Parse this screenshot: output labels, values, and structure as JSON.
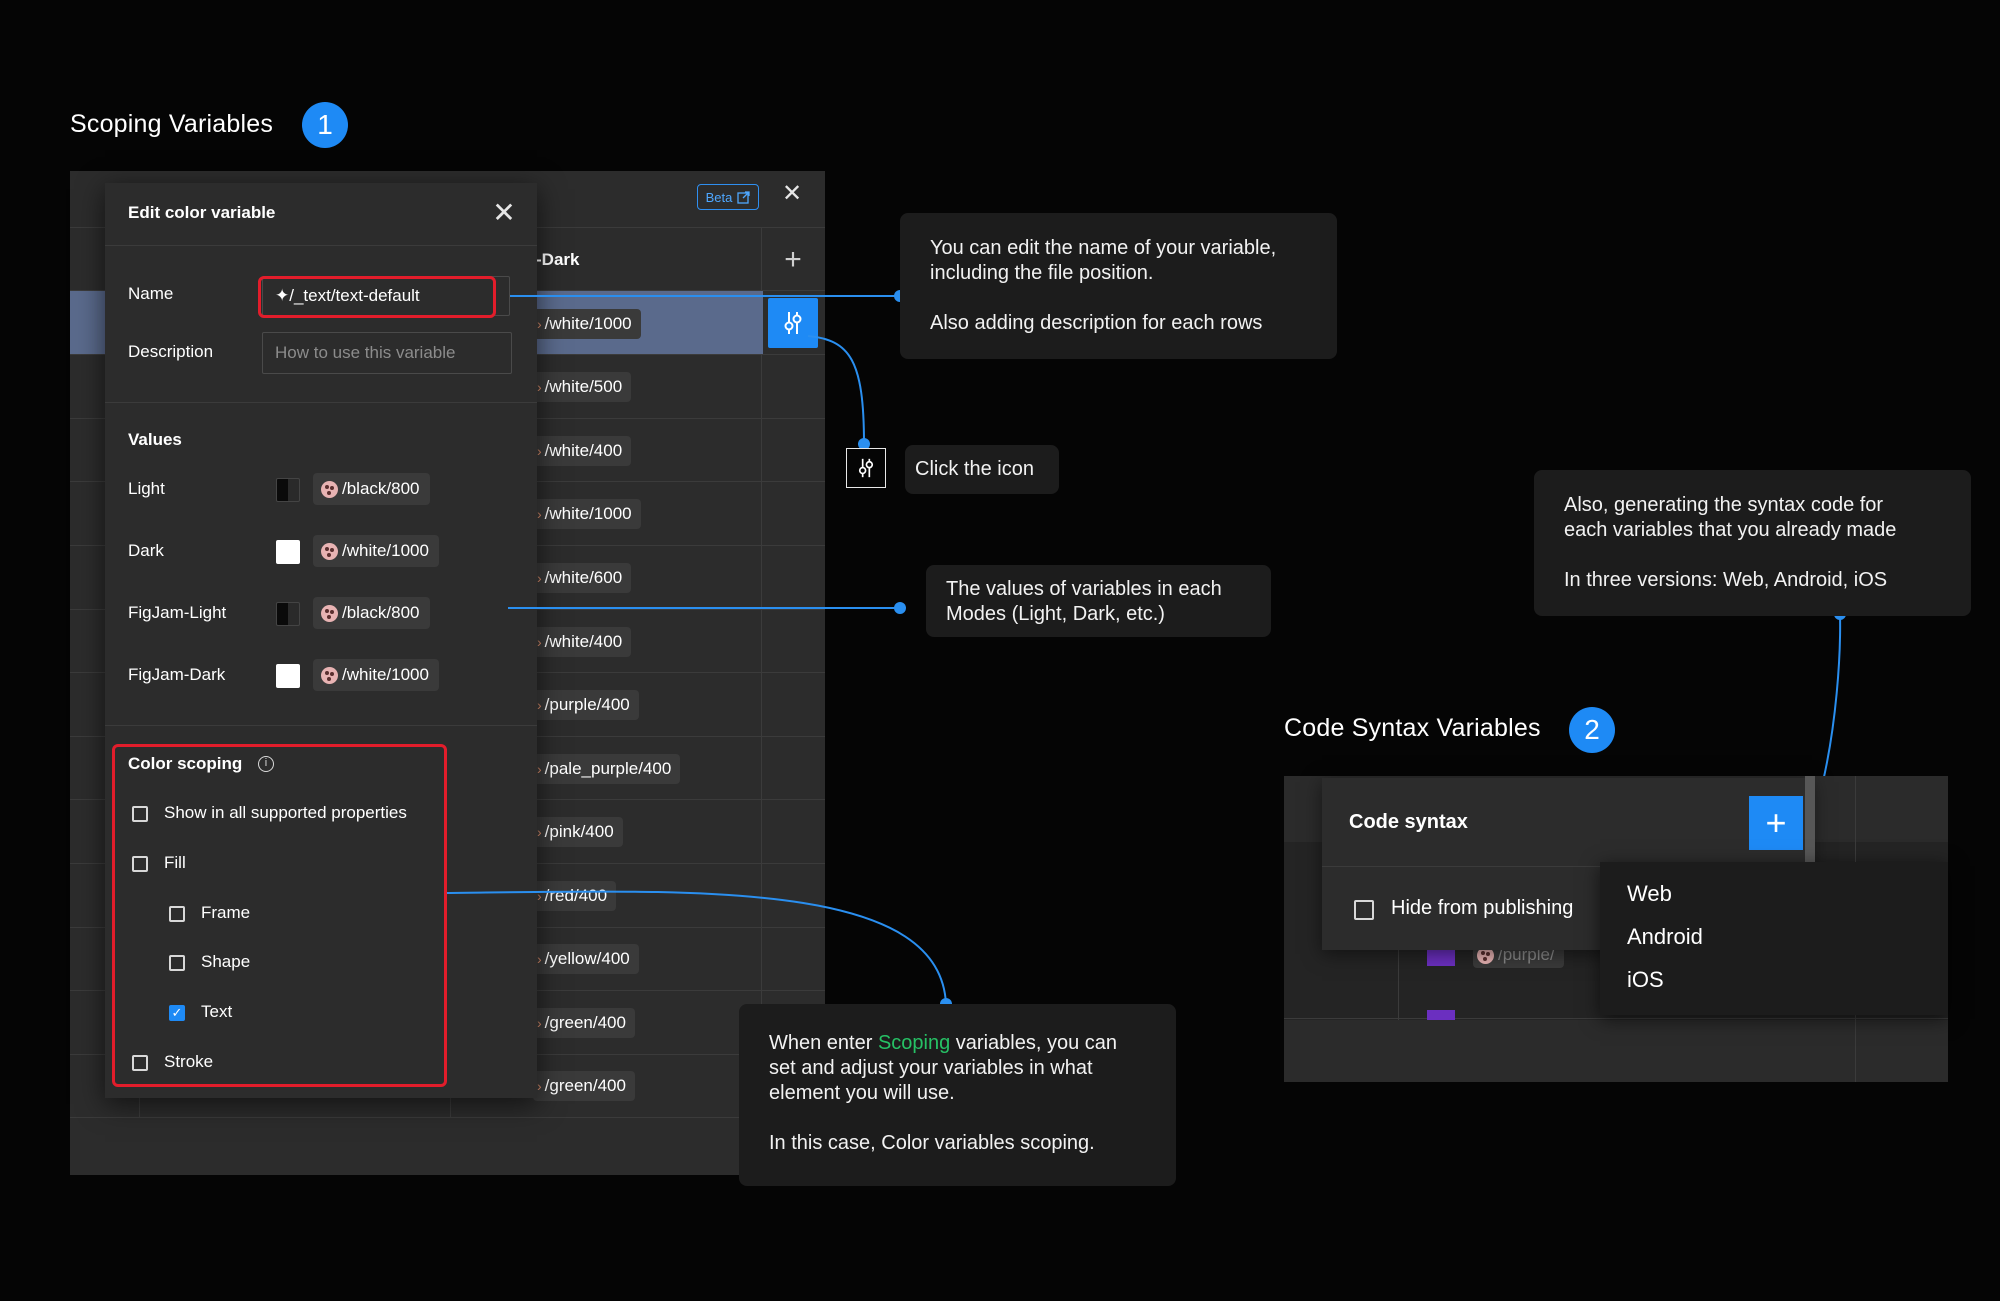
{
  "section1": {
    "title": "Scoping Variables",
    "step": "1"
  },
  "section2": {
    "title": "Code Syntax Variables",
    "step": "2"
  },
  "table": {
    "beta_label": "Beta",
    "dark_header": "-Dark",
    "dark_values": [
      "/white/1000",
      "/white/500",
      "/white/400",
      "/white/1000",
      "/white/600",
      "/white/400",
      "/purple/400",
      "/pale_purple/400",
      "/pink/400",
      "/red/400",
      "/yellow/400",
      "/green/400",
      "/green/400"
    ]
  },
  "modal": {
    "title": "Edit color variable",
    "name_label": "Name",
    "name_value": "✦/_text/text-default",
    "description_label": "Description",
    "description_placeholder": "How to use this variable",
    "values_heading": "Values",
    "values": [
      {
        "mode": "Light",
        "swatch": "dark",
        "value": "/black/800"
      },
      {
        "mode": "Dark",
        "swatch": "white",
        "value": "/white/1000"
      },
      {
        "mode": "FigJam-Light",
        "swatch": "dark",
        "value": "/black/800"
      },
      {
        "mode": "FigJam-Dark",
        "swatch": "white",
        "value": "/white/1000"
      }
    ],
    "scoping_heading": "Color scoping",
    "scoping_options": [
      {
        "label": "Show in all supported properties",
        "checked": false,
        "indent": false
      },
      {
        "label": "Fill",
        "checked": false,
        "indent": false
      },
      {
        "label": "Frame",
        "checked": false,
        "indent": true
      },
      {
        "label": "Shape",
        "checked": false,
        "indent": true
      },
      {
        "label": "Text",
        "checked": true,
        "indent": true
      },
      {
        "label": "Stroke",
        "checked": false,
        "indent": false
      }
    ]
  },
  "callouts": {
    "name_line1": "You can edit the name of your variable,",
    "name_line2": "including the file position.",
    "name_line3": "Also adding description for each rows",
    "click_icon": "Click the icon",
    "values_line1": "The values of variables in each",
    "values_line2": "Modes (Light, Dark, etc.)",
    "scoping_pre": "When enter ",
    "scoping_highlight": "Scoping",
    "scoping_post": " variables, you can",
    "scoping_line2": "set and adjust your variables in what",
    "scoping_line3": "element you will use.",
    "scoping_line4": "In this case, Color variables scoping.",
    "syntax_line1": "Also, generating the syntax code for",
    "syntax_line2": "each variables that you already made",
    "syntax_line3": "In three versions: Web, Android, iOS"
  },
  "code_syntax": {
    "title": "Code syntax",
    "hide_label": "Hide from publishing",
    "menu": [
      "Web",
      "Android",
      "iOS"
    ],
    "peek_value": "/purple/"
  },
  "colors": {
    "accent": "#1e8af5",
    "highlight_red": "#e21d2b",
    "scoping_green": "#26c165"
  }
}
